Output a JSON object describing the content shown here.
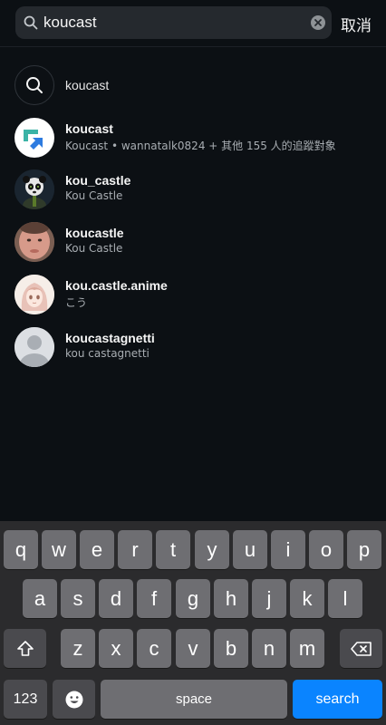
{
  "search": {
    "value": "koucast",
    "cancel_label": "取消"
  },
  "results": [
    {
      "type": "keyword",
      "title": "koucast",
      "subtitle": ""
    },
    {
      "type": "account",
      "title": "koucast",
      "subtitle": "Koucast • wannatalk0824 + 其他 155 人的追蹤對象",
      "avatar": "koucast-logo"
    },
    {
      "type": "account",
      "title": "kou_castle",
      "subtitle": "Kou Castle",
      "avatar": "panda-character"
    },
    {
      "type": "account",
      "title": "koucastle",
      "subtitle": "Kou Castle",
      "avatar": "person-photo"
    },
    {
      "type": "account",
      "title": "kou.castle.anime",
      "subtitle": "こう",
      "avatar": "anime-girl"
    },
    {
      "type": "account",
      "title": "koucastagnetti",
      "subtitle": "kou castagnetti",
      "avatar": "default-person"
    }
  ],
  "keyboard": {
    "row1": [
      "q",
      "w",
      "e",
      "r",
      "t",
      "y",
      "u",
      "i",
      "o",
      "p"
    ],
    "row2": [
      "a",
      "s",
      "d",
      "f",
      "g",
      "h",
      "j",
      "k",
      "l"
    ],
    "row3": [
      "z",
      "x",
      "c",
      "v",
      "b",
      "n",
      "m"
    ],
    "numbers_label": "123",
    "space_label": "space",
    "search_label": "search"
  },
  "colors": {
    "background": "#0c1014",
    "accent": "#0a84ff"
  }
}
